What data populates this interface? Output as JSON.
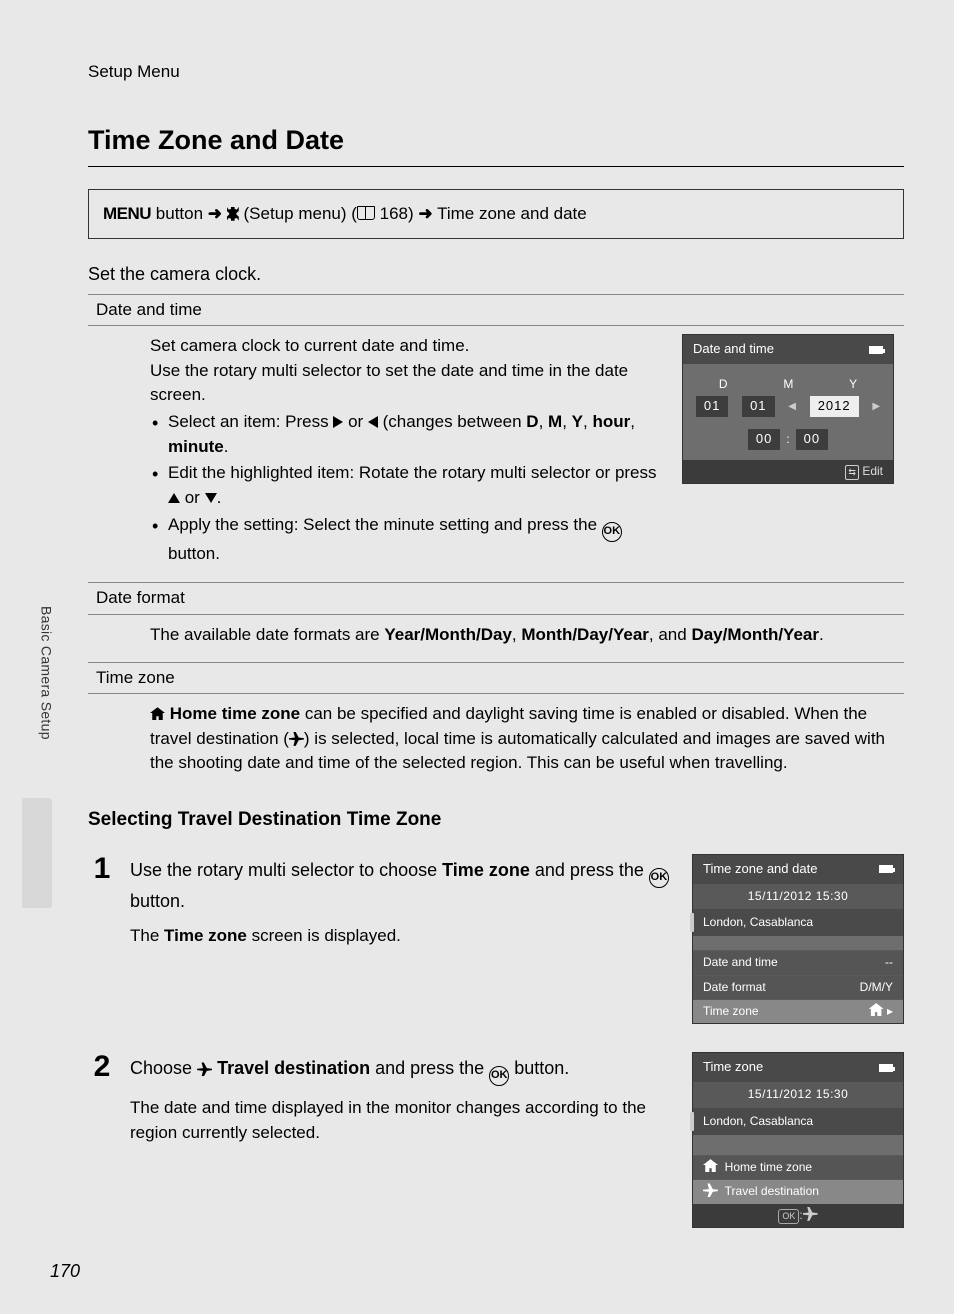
{
  "breadcrumb": "Setup Menu",
  "title": "Time Zone and Date",
  "nav": {
    "menu_label": "MENU",
    "button_word": "button",
    "setup_label": "(Setup menu)",
    "page_ref": "168",
    "dest": "Time zone and date"
  },
  "intro": "Set the camera clock.",
  "sections": {
    "date_time": {
      "header": "Date and time",
      "p1": "Set camera clock to current date and time.",
      "p2": "Use the rotary multi selector to set the date and time in the date screen.",
      "b1_a": "Select an item: Press ",
      "b1_b": " or ",
      "b1_c": " (changes between ",
      "b1_items": "D, M, Y, hour, minute",
      "b1_end": ".",
      "b2_a": "Edit the highlighted item: Rotate the rotary multi selector or press ",
      "b2_b": " or ",
      "b2_c": ".",
      "b3_a": "Apply the setting: Select the minute setting and press the ",
      "b3_b": " button."
    },
    "date_format": {
      "header": "Date format",
      "text_a": "The available date formats are ",
      "opt1": "Year/Month/Day",
      "sep1": ", ",
      "opt2": "Month/Day/Year",
      "sep2": ", and ",
      "opt3": "Day/Month/Year",
      "end": "."
    },
    "time_zone": {
      "header": "Time zone",
      "bold": "Home time zone",
      "text": " can be specified and daylight saving time is enabled or disabled. When the travel destination (",
      "text2": ") is selected, local time is automatically calculated and images are saved with the shooting date and time of the selected region. This can be useful when travelling."
    }
  },
  "subhead": "Selecting Travel Destination Time Zone",
  "steps": {
    "s1": {
      "num": "1",
      "lead_a": "Use the rotary multi selector to choose ",
      "lead_b": "Time zone",
      "lead_c": " and press the ",
      "lead_d": " button.",
      "sub_a": "The ",
      "sub_b": "Time zone",
      "sub_c": " screen is displayed."
    },
    "s2": {
      "num": "2",
      "lead_a": "Choose ",
      "lead_b": "Travel destination",
      "lead_c": " and press the ",
      "lead_d": " button.",
      "sub": "The date and time displayed in the monitor changes according to the region currently selected."
    }
  },
  "lcd1": {
    "title": "Date and time",
    "labels": {
      "d": "D",
      "m": "M",
      "y": "Y"
    },
    "values": {
      "d": "01",
      "m": "01",
      "y": "2012",
      "hh": "00",
      "mm": "00"
    },
    "edit": "Edit"
  },
  "lcd2": {
    "title": "Time zone and date",
    "datetime": "15/11/2012 15:30",
    "location": "London, Casablanca",
    "items": {
      "date_time": "Date and time",
      "date_time_val": "--",
      "date_format": "Date format",
      "date_format_val": "D/M/Y",
      "time_zone": "Time zone"
    }
  },
  "lcd3": {
    "title": "Time zone",
    "datetime": "15/11/2012 15:30",
    "location": "London, Casablanca",
    "home": "Home time zone",
    "travel": "Travel destination"
  },
  "side_tab": "Basic Camera Setup",
  "page_number": "170",
  "ok_label": "OK"
}
